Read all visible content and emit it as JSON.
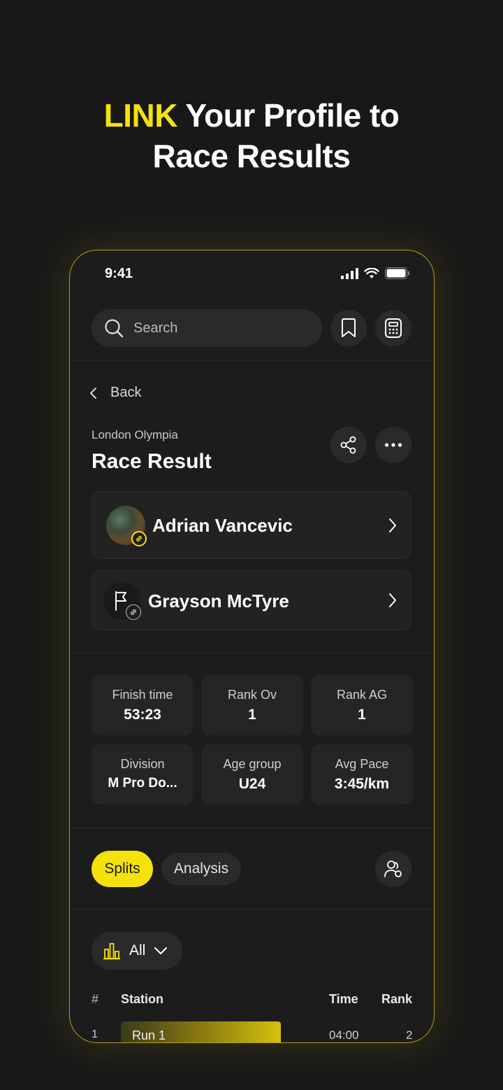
{
  "headline": {
    "accent": "LINK",
    "rest_line1": " Your Profile to",
    "line2": "Race Results"
  },
  "status_bar": {
    "time": "9:41"
  },
  "search": {
    "placeholder": "Search"
  },
  "nav": {
    "back_label": "Back"
  },
  "result": {
    "venue": "London Olympia",
    "title": "Race Result",
    "athletes": [
      {
        "name": "Adrian Vancevic",
        "linked": true
      },
      {
        "name": "Grayson McTyre",
        "linked": false
      }
    ]
  },
  "stats": [
    {
      "label": "Finish time",
      "value": "53:23"
    },
    {
      "label": "Rank Ov",
      "value": "1"
    },
    {
      "label": "Rank AG",
      "value": "1"
    },
    {
      "label": "Division",
      "value": "M Pro Do..."
    },
    {
      "label": "Age group",
      "value": "U24"
    },
    {
      "label": "Avg Pace",
      "value": "3:45/km"
    }
  ],
  "tabs": {
    "splits": "Splits",
    "analysis": "Analysis",
    "active": "Splits"
  },
  "filter": {
    "selected": "All"
  },
  "table": {
    "headers": {
      "hash": "#",
      "station": "Station",
      "time": "Time",
      "rank": "Rank"
    },
    "rows": [
      {
        "num": "1",
        "station": "Run 1",
        "time": "04:00",
        "rank": "2"
      }
    ]
  },
  "colors": {
    "accent": "#f5e20a",
    "background": "#181818",
    "card": "#222222"
  },
  "icons": [
    "search-icon",
    "bookmark-icon",
    "calculator-icon",
    "chevron-left-icon",
    "share-icon",
    "more-icon",
    "chevron-right-icon",
    "link-icon",
    "flag-icon",
    "compare-users-icon",
    "bar-chart-icon",
    "chevron-down-icon"
  ]
}
